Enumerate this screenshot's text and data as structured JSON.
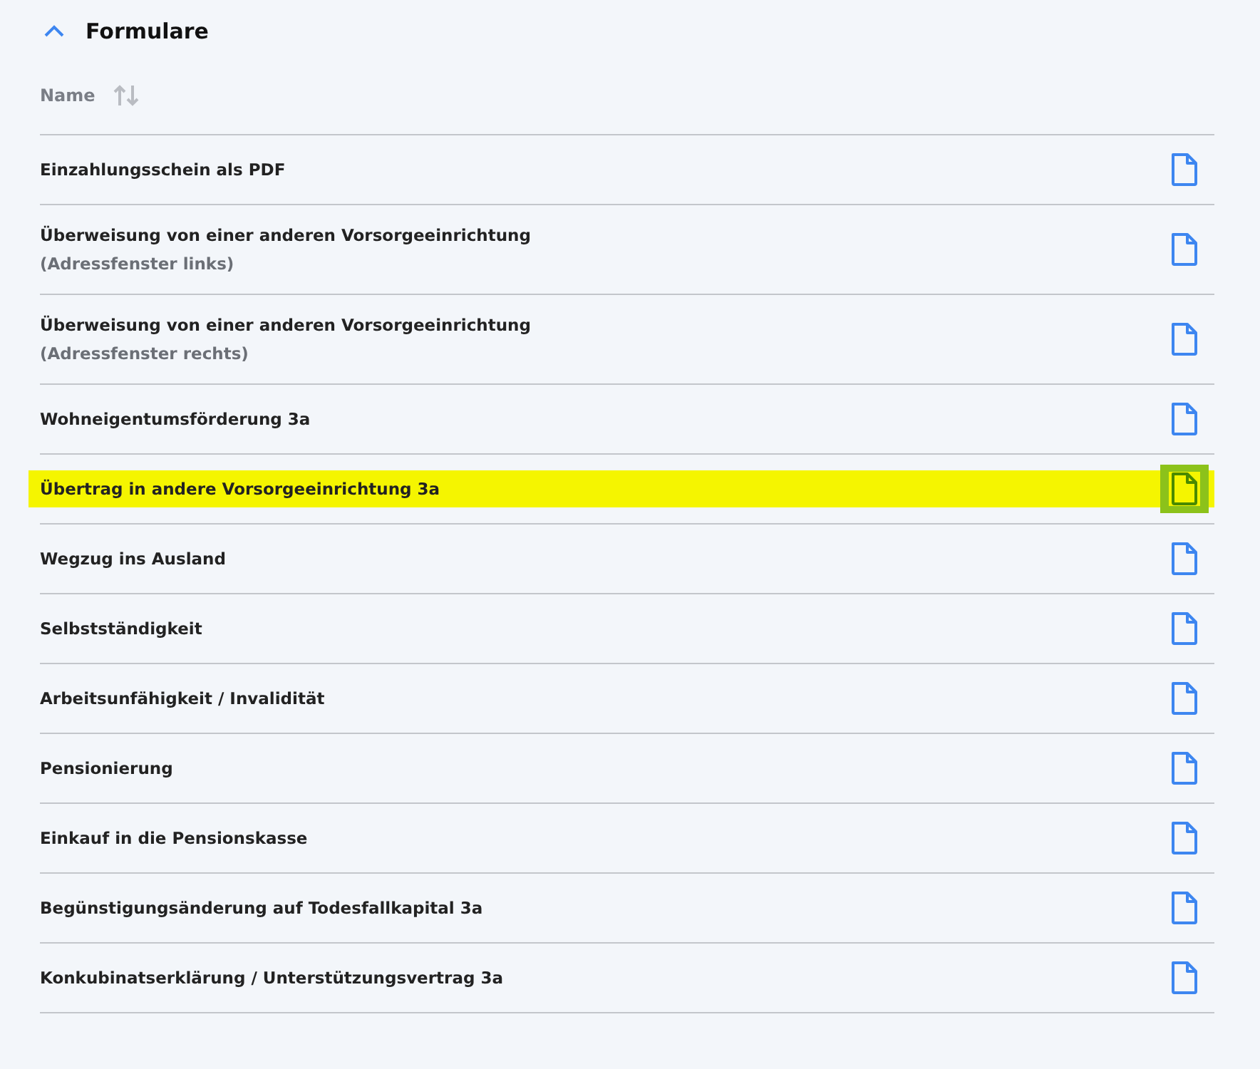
{
  "section": {
    "title": "Formulare",
    "expanded": true
  },
  "table": {
    "columns": [
      "Name"
    ],
    "rows": [
      {
        "title": "Einzahlungsschein als PDF",
        "highlighted": false
      },
      {
        "title": "Überweisung von einer anderen Vorsorgeeinrichtung",
        "subtitle": "(Adressfenster links)",
        "highlighted": false
      },
      {
        "title": "Überweisung von einer anderen Vorsorgeeinrichtung",
        "subtitle": "(Adressfenster rechts)",
        "highlighted": false
      },
      {
        "title": "Wohneigentumsförderung 3a",
        "highlighted": false
      },
      {
        "title": "Übertrag in andere Vorsorgeeinrichtung 3a",
        "highlighted": true
      },
      {
        "title": "Wegzug ins Ausland",
        "highlighted": false
      },
      {
        "title": "Selbstständigkeit",
        "highlighted": false
      },
      {
        "title": "Arbeitsunfähigkeit / Invalidität",
        "highlighted": false
      },
      {
        "title": "Pensionierung",
        "highlighted": false
      },
      {
        "title": "Einkauf in die Pensionskasse",
        "highlighted": false
      },
      {
        "title": "Begünstigungsänderung auf Todesfallkapital 3a",
        "highlighted": false
      },
      {
        "title": "Konkubinatserklärung / Unterstützungsvertrag 3a",
        "highlighted": false
      }
    ]
  }
}
